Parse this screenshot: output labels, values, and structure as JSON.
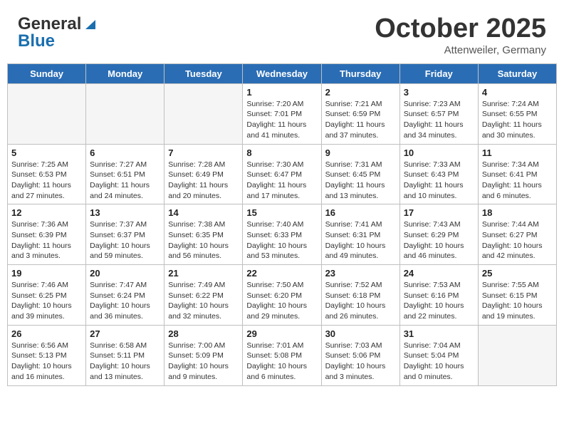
{
  "header": {
    "logo_line1": "General",
    "logo_line2": "Blue",
    "month": "October 2025",
    "location": "Attenweiler, Germany"
  },
  "days_of_week": [
    "Sunday",
    "Monday",
    "Tuesday",
    "Wednesday",
    "Thursday",
    "Friday",
    "Saturday"
  ],
  "weeks": [
    {
      "shaded": false,
      "days": [
        {
          "num": "",
          "info": ""
        },
        {
          "num": "",
          "info": ""
        },
        {
          "num": "",
          "info": ""
        },
        {
          "num": "1",
          "info": "Sunrise: 7:20 AM\nSunset: 7:01 PM\nDaylight: 11 hours and 41 minutes."
        },
        {
          "num": "2",
          "info": "Sunrise: 7:21 AM\nSunset: 6:59 PM\nDaylight: 11 hours and 37 minutes."
        },
        {
          "num": "3",
          "info": "Sunrise: 7:23 AM\nSunset: 6:57 PM\nDaylight: 11 hours and 34 minutes."
        },
        {
          "num": "4",
          "info": "Sunrise: 7:24 AM\nSunset: 6:55 PM\nDaylight: 11 hours and 30 minutes."
        }
      ]
    },
    {
      "shaded": true,
      "days": [
        {
          "num": "5",
          "info": "Sunrise: 7:25 AM\nSunset: 6:53 PM\nDaylight: 11 hours and 27 minutes."
        },
        {
          "num": "6",
          "info": "Sunrise: 7:27 AM\nSunset: 6:51 PM\nDaylight: 11 hours and 24 minutes."
        },
        {
          "num": "7",
          "info": "Sunrise: 7:28 AM\nSunset: 6:49 PM\nDaylight: 11 hours and 20 minutes."
        },
        {
          "num": "8",
          "info": "Sunrise: 7:30 AM\nSunset: 6:47 PM\nDaylight: 11 hours and 17 minutes."
        },
        {
          "num": "9",
          "info": "Sunrise: 7:31 AM\nSunset: 6:45 PM\nDaylight: 11 hours and 13 minutes."
        },
        {
          "num": "10",
          "info": "Sunrise: 7:33 AM\nSunset: 6:43 PM\nDaylight: 11 hours and 10 minutes."
        },
        {
          "num": "11",
          "info": "Sunrise: 7:34 AM\nSunset: 6:41 PM\nDaylight: 11 hours and 6 minutes."
        }
      ]
    },
    {
      "shaded": false,
      "days": [
        {
          "num": "12",
          "info": "Sunrise: 7:36 AM\nSunset: 6:39 PM\nDaylight: 11 hours and 3 minutes."
        },
        {
          "num": "13",
          "info": "Sunrise: 7:37 AM\nSunset: 6:37 PM\nDaylight: 10 hours and 59 minutes."
        },
        {
          "num": "14",
          "info": "Sunrise: 7:38 AM\nSunset: 6:35 PM\nDaylight: 10 hours and 56 minutes."
        },
        {
          "num": "15",
          "info": "Sunrise: 7:40 AM\nSunset: 6:33 PM\nDaylight: 10 hours and 53 minutes."
        },
        {
          "num": "16",
          "info": "Sunrise: 7:41 AM\nSunset: 6:31 PM\nDaylight: 10 hours and 49 minutes."
        },
        {
          "num": "17",
          "info": "Sunrise: 7:43 AM\nSunset: 6:29 PM\nDaylight: 10 hours and 46 minutes."
        },
        {
          "num": "18",
          "info": "Sunrise: 7:44 AM\nSunset: 6:27 PM\nDaylight: 10 hours and 42 minutes."
        }
      ]
    },
    {
      "shaded": true,
      "days": [
        {
          "num": "19",
          "info": "Sunrise: 7:46 AM\nSunset: 6:25 PM\nDaylight: 10 hours and 39 minutes."
        },
        {
          "num": "20",
          "info": "Sunrise: 7:47 AM\nSunset: 6:24 PM\nDaylight: 10 hours and 36 minutes."
        },
        {
          "num": "21",
          "info": "Sunrise: 7:49 AM\nSunset: 6:22 PM\nDaylight: 10 hours and 32 minutes."
        },
        {
          "num": "22",
          "info": "Sunrise: 7:50 AM\nSunset: 6:20 PM\nDaylight: 10 hours and 29 minutes."
        },
        {
          "num": "23",
          "info": "Sunrise: 7:52 AM\nSunset: 6:18 PM\nDaylight: 10 hours and 26 minutes."
        },
        {
          "num": "24",
          "info": "Sunrise: 7:53 AM\nSunset: 6:16 PM\nDaylight: 10 hours and 22 minutes."
        },
        {
          "num": "25",
          "info": "Sunrise: 7:55 AM\nSunset: 6:15 PM\nDaylight: 10 hours and 19 minutes."
        }
      ]
    },
    {
      "shaded": false,
      "days": [
        {
          "num": "26",
          "info": "Sunrise: 6:56 AM\nSunset: 5:13 PM\nDaylight: 10 hours and 16 minutes."
        },
        {
          "num": "27",
          "info": "Sunrise: 6:58 AM\nSunset: 5:11 PM\nDaylight: 10 hours and 13 minutes."
        },
        {
          "num": "28",
          "info": "Sunrise: 7:00 AM\nSunset: 5:09 PM\nDaylight: 10 hours and 9 minutes."
        },
        {
          "num": "29",
          "info": "Sunrise: 7:01 AM\nSunset: 5:08 PM\nDaylight: 10 hours and 6 minutes."
        },
        {
          "num": "30",
          "info": "Sunrise: 7:03 AM\nSunset: 5:06 PM\nDaylight: 10 hours and 3 minutes."
        },
        {
          "num": "31",
          "info": "Sunrise: 7:04 AM\nSunset: 5:04 PM\nDaylight: 10 hours and 0 minutes."
        },
        {
          "num": "",
          "info": ""
        }
      ]
    }
  ]
}
